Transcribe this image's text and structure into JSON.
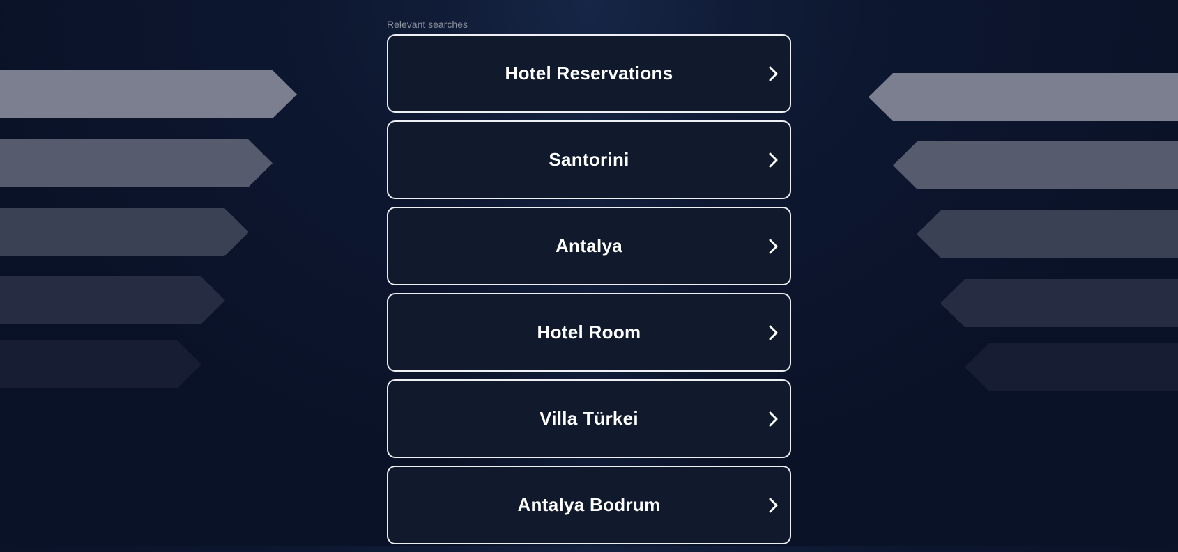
{
  "heading": "Relevant searches",
  "items": [
    {
      "label": "Hotel Reservations",
      "name": "result-hotel-reservations"
    },
    {
      "label": "Santorini",
      "name": "result-santorini"
    },
    {
      "label": "Antalya",
      "name": "result-antalya"
    },
    {
      "label": "Hotel Room",
      "name": "result-hotel-room"
    },
    {
      "label": "Villa Türkei",
      "name": "result-villa-turkei"
    },
    {
      "label": "Antalya Bodrum",
      "name": "result-antalya-bodrum"
    }
  ],
  "icons": {
    "item_arrow": "chevron-right-icon"
  },
  "colors": {
    "background": "#0a1227",
    "card_background": "#111a2d",
    "card_border": "#eef0f4",
    "label_text": "#ffffff",
    "heading_text": "#8a8f9c"
  }
}
